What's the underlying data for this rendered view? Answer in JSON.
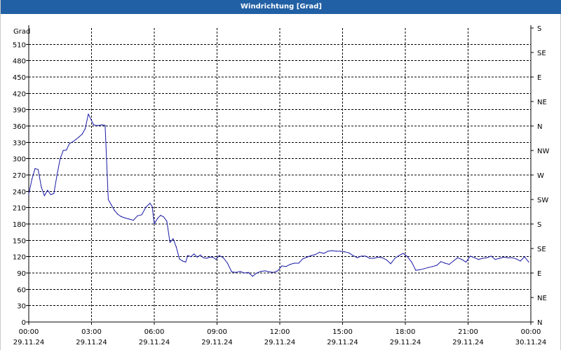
{
  "window": {
    "title": "Windrichtung [Grad]"
  },
  "colors": {
    "title_bar": "#2160a4",
    "series_line": "#1a1aa6",
    "grid": "#000000"
  },
  "chart_data": {
    "type": "line",
    "title": "Windrichtung [Grad]",
    "ylabel": "Grad",
    "ylim": [
      0,
      540
    ],
    "yticks": [
      0,
      30,
      60,
      90,
      120,
      150,
      180,
      210,
      240,
      270,
      300,
      330,
      360,
      390,
      420,
      450,
      480,
      510
    ],
    "y2_ticks": [
      {
        "value": 0,
        "label": "N"
      },
      {
        "value": 45,
        "label": "NE"
      },
      {
        "value": 90,
        "label": "E"
      },
      {
        "value": 135,
        "label": "SE"
      },
      {
        "value": 180,
        "label": "S"
      },
      {
        "value": 225,
        "label": "SW"
      },
      {
        "value": 270,
        "label": "W"
      },
      {
        "value": 315,
        "label": "NW"
      },
      {
        "value": 360,
        "label": "N"
      },
      {
        "value": 405,
        "label": "NE"
      },
      {
        "value": 450,
        "label": "E"
      },
      {
        "value": 495,
        "label": "SE"
      },
      {
        "value": 540,
        "label": "S"
      }
    ],
    "xlim": [
      0,
      24
    ],
    "xticks": [
      {
        "x": 0,
        "time": "00:00",
        "date": "29.11.24"
      },
      {
        "x": 3,
        "time": "03:00",
        "date": "29.11.24"
      },
      {
        "x": 6,
        "time": "06:00",
        "date": "29.11.24"
      },
      {
        "x": 9,
        "time": "09:00",
        "date": "29.11.24"
      },
      {
        "x": 12,
        "time": "12:00",
        "date": "29.11.24"
      },
      {
        "x": 15,
        "time": "15:00",
        "date": "29.11.24"
      },
      {
        "x": 18,
        "time": "18:00",
        "date": "29.11.24"
      },
      {
        "x": 21,
        "time": "21:00",
        "date": "29.11.24"
      },
      {
        "x": 24,
        "time": "00:00",
        "date": "30.11.24"
      }
    ],
    "grid": true,
    "series": [
      {
        "x": [
          0,
          0.15,
          0.3,
          0.45,
          0.6,
          0.75,
          0.9,
          1.05,
          1.2,
          1.35,
          1.5,
          1.65,
          1.8,
          1.95,
          2.1,
          2.25,
          2.4,
          2.55,
          2.7,
          2.85,
          3.0,
          3.1,
          3.2,
          3.35,
          3.5,
          3.65,
          3.8,
          3.95,
          4.1,
          4.25,
          4.4,
          4.6,
          4.8,
          5.0,
          5.2,
          5.4,
          5.6,
          5.8,
          5.9,
          6.0,
          6.15,
          6.3,
          6.45,
          6.6,
          6.75,
          6.9,
          7.05,
          7.2,
          7.35,
          7.5,
          7.6,
          7.75,
          7.9,
          8.05,
          8.2,
          8.35,
          8.5,
          8.65,
          8.8,
          8.95,
          9.1,
          9.3,
          9.5,
          9.7,
          9.9,
          10.1,
          10.3,
          10.5,
          10.7,
          10.9,
          11.1,
          11.3,
          11.5,
          11.7,
          11.9,
          12.1,
          12.3,
          12.5,
          12.7,
          12.9,
          13.1,
          13.3,
          13.5,
          13.7,
          13.9,
          14.1,
          14.3,
          14.5,
          14.7,
          14.9,
          15.1,
          15.3,
          15.5,
          15.7,
          15.9,
          16.1,
          16.3,
          16.5,
          16.7,
          16.9,
          17.1,
          17.3,
          17.5,
          17.7,
          17.9,
          18.1,
          18.3,
          18.5,
          18.7,
          18.9,
          19.1,
          19.3,
          19.5,
          19.7,
          19.9,
          20.1,
          20.3,
          20.5,
          20.7,
          20.9,
          21.1,
          21.3,
          21.5,
          21.7,
          21.9,
          22.1,
          22.3,
          22.5,
          22.7,
          22.9,
          23.1,
          23.3,
          23.5,
          23.7,
          23.9
        ],
        "values": [
          235,
          262,
          282,
          280,
          248,
          232,
          242,
          234,
          236,
          270,
          300,
          315,
          316,
          328,
          331,
          335,
          340,
          345,
          355,
          382,
          370,
          362,
          361,
          361,
          362,
          361,
          225,
          215,
          205,
          198,
          194,
          191,
          189,
          187,
          195,
          197,
          211,
          218,
          212,
          180,
          190,
          196,
          193,
          185,
          146,
          153,
          138,
          116,
          112,
          110,
          122,
          120,
          125,
          119,
          123,
          118,
          117,
          119,
          119,
          115,
          122,
          118,
          108,
          92,
          91,
          93,
          90,
          91,
          84,
          90,
          93,
          94,
          92,
          91,
          94,
          103,
          102,
          106,
          108,
          108,
          116,
          119,
          122,
          124,
          128,
          126,
          130,
          131,
          130,
          130,
          129,
          127,
          122,
          118,
          121,
          121,
          117,
          117,
          119,
          118,
          114,
          107,
          117,
          122,
          126,
          120,
          110,
          95,
          96,
          98,
          100,
          102,
          104,
          111,
          108,
          106,
          112,
          118,
          115,
          110,
          121,
          118,
          115,
          117,
          118,
          121,
          115,
          117,
          119,
          118,
          118,
          116,
          112,
          120,
          110
        ]
      }
    ]
  }
}
